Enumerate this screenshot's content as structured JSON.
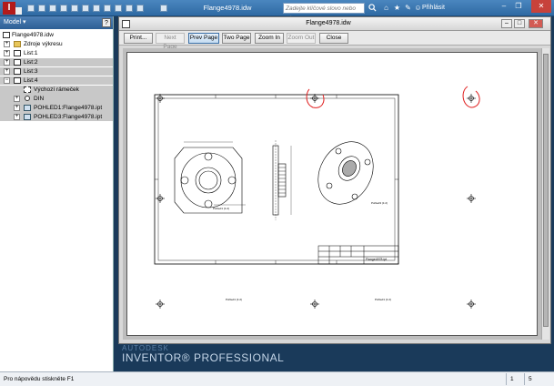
{
  "app": {
    "title": "Flange4978.idw",
    "logo": "I",
    "search_placeholder": "Zadejte klíčové slovo nebo výraz",
    "sign_in": "Přihlásit",
    "brand_line1": "AUTODESK",
    "brand_line2": "INVENTOR® PROFESSIONAL",
    "accent_color": "#2f6aa3"
  },
  "browser": {
    "title": "Model ▾",
    "help": "?",
    "items": [
      {
        "label": "Flange4978.idw",
        "icon": "drawing-doc-icon",
        "expander": "",
        "indent": 0
      },
      {
        "label": "Zdroje výkresu",
        "icon": "folder-icon",
        "expander": "+",
        "indent": 1
      },
      {
        "label": "List:1",
        "icon": "sheet-icon",
        "expander": "+",
        "indent": 1
      },
      {
        "label": "List:2",
        "icon": "sheet-icon",
        "expander": "+",
        "indent": 1
      },
      {
        "label": "List:3",
        "icon": "sheet-icon",
        "expander": "+",
        "indent": 1
      },
      {
        "label": "List:4",
        "icon": "sheet-icon",
        "expander": "−",
        "indent": 1
      },
      {
        "label": "Výchozí rámeček",
        "icon": "frame-icon",
        "expander": "",
        "indent": 2
      },
      {
        "label": "DIN",
        "icon": "title-block-icon",
        "expander": "+",
        "indent": 2
      },
      {
        "label": "POHLED1:Flange4978.ipt",
        "icon": "view-icon",
        "expander": "+",
        "indent": 2
      },
      {
        "label": "POHLED3:Flange4978.ipt",
        "icon": "view-icon",
        "expander": "+",
        "indent": 2
      }
    ]
  },
  "drawing_window": {
    "title": "Flange4978.idw",
    "buttons": {
      "print": "Print...",
      "next_page": "Next Page",
      "prev_page": "Prev Page",
      "two_page": "Two Page",
      "zoom_in": "Zoom In",
      "zoom_out": "Zoom Out",
      "close": "Close"
    }
  },
  "sheet": {
    "sheet_label": "Flange4978.ipt",
    "annotation_color": "#e02020"
  },
  "status": {
    "help_text": "Pro nápovědu stiskněte F1",
    "count_a": "1",
    "count_b": "5"
  }
}
